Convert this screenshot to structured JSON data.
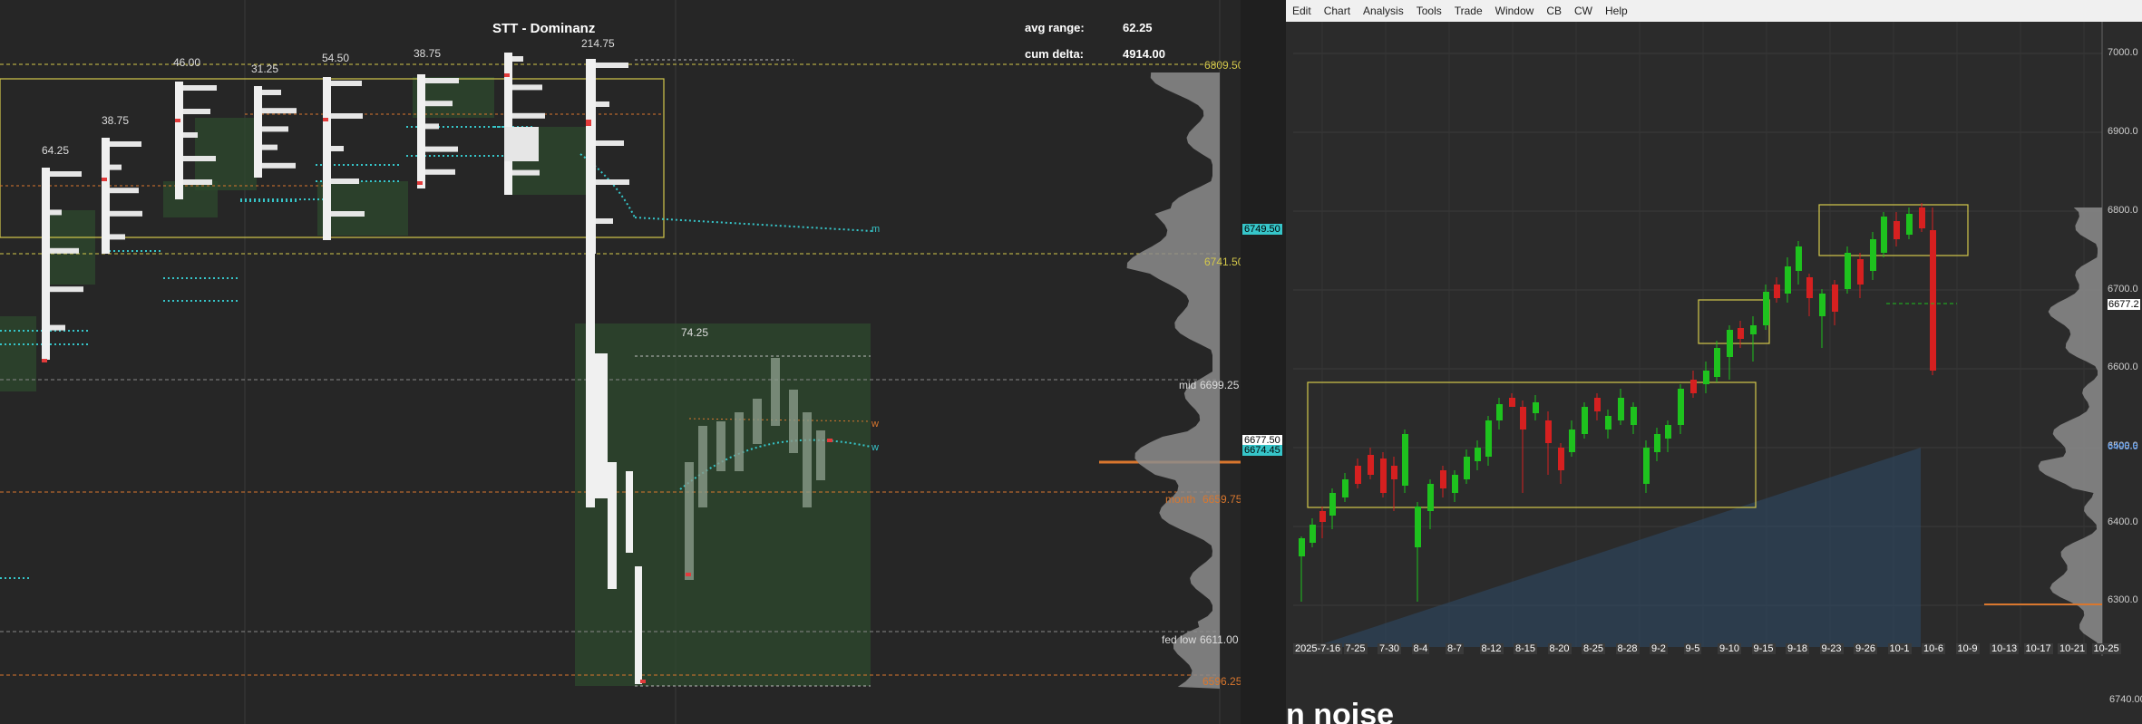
{
  "left_chart": {
    "title": "STT - Dominanz",
    "stats": [
      {
        "label": "avg range:",
        "value": "62.25"
      },
      {
        "label": "cum delta:",
        "value": "4914.00"
      }
    ],
    "range_labels": [
      "64.25",
      "38.75",
      "46.00",
      "31.25",
      "54.50",
      "38.75",
      "214.75",
      "74.25"
    ],
    "price_levels": [
      {
        "name": "",
        "price": "6809.50",
        "color": "#d4c84a"
      },
      {
        "name": "",
        "price": "6741.50",
        "color": "#d4c84a"
      },
      {
        "name": "mid",
        "price": "6699.25",
        "color": "#dddddd"
      },
      {
        "name": "month",
        "price": "6659.75",
        "color": "#d9772e"
      },
      {
        "name": "fed low",
        "price": "6611.00",
        "color": "#dddddd"
      },
      {
        "name": "",
        "price": "6596.25",
        "color": "#d9772e"
      }
    ],
    "current_tags": [
      {
        "price": "6749.50",
        "bg": "#36c5c9"
      },
      {
        "price": "6677.50",
        "bg": "#ffffff"
      },
      {
        "price": "6674.45",
        "bg": "#36c5c9"
      }
    ],
    "line_marks": [
      "m",
      "w",
      "w"
    ]
  },
  "right_chart": {
    "menu": [
      "Edit",
      "Chart",
      "Analysis",
      "Tools",
      "Trade",
      "Window",
      "CB",
      "CW",
      "Help"
    ],
    "y_axis": [
      "7000.0",
      "6900.0",
      "6800.0",
      "6700.0",
      "6600.0",
      "6500.0",
      "6400.0",
      "6300.0"
    ],
    "price_tags": [
      {
        "price": "6677.2",
        "color": "#ffffff"
      },
      {
        "price": "6495.6",
        "color": "#5aa0ff"
      }
    ],
    "x_axis": [
      "2025-7-16",
      "7-25",
      "7-30",
      "8-4",
      "8-7",
      "8-12",
      "8-15",
      "8-20",
      "8-25",
      "8-28",
      "9-2",
      "9-5",
      "9-10",
      "9-15",
      "9-18",
      "9-23",
      "9-26",
      "10-1",
      "10-6",
      "10-9",
      "10-13",
      "10-17",
      "10-21",
      "10-25"
    ],
    "lower_price": "6740.00",
    "partial_text": "n noise"
  }
}
